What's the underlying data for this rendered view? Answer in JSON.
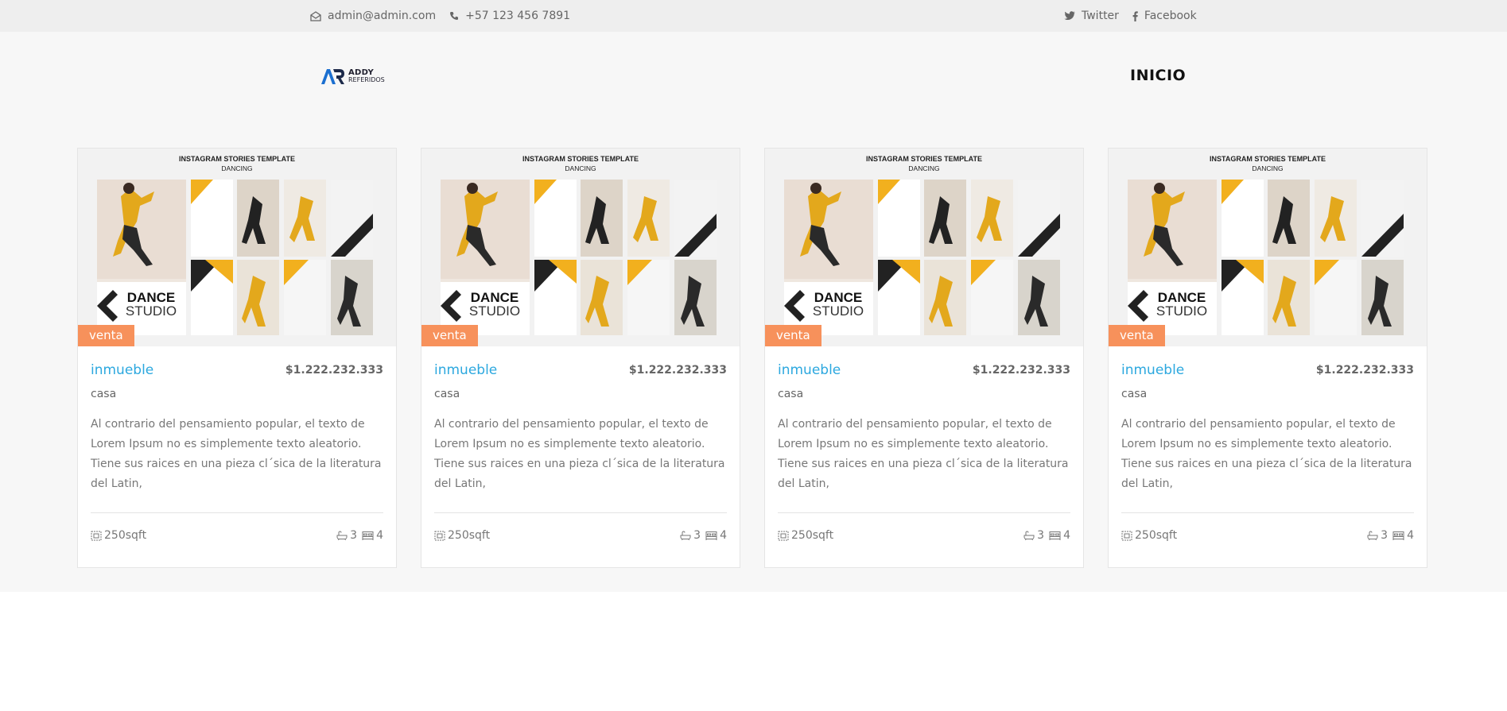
{
  "topbar": {
    "email": "admin@admin.com",
    "phone": "+57 123 456 7891",
    "twitter": "Twitter",
    "facebook": "Facebook"
  },
  "header": {
    "logo_line1": "ADDY",
    "logo_line2": "REFERIDOS",
    "nav_item": "INICIO"
  },
  "listings": [
    {
      "poster_title": "INSTAGRAM STORIES TEMPLATE",
      "poster_subtitle": "DANCING",
      "poster_brand": "DANCE",
      "poster_brand2": "STUDIO",
      "badge": "venta",
      "title": "inmueble",
      "price": "$1.222.232.333",
      "type": "casa",
      "description": "Al contrario del pensamiento popular, el texto de Lorem Ipsum no es simplemente texto aleatorio. Tiene sus raices en una pieza cl´sica de la literatura del Latin,",
      "area": "250sqft",
      "baths": "3",
      "beds": "4"
    },
    {
      "poster_title": "INSTAGRAM STORIES TEMPLATE",
      "poster_subtitle": "DANCING",
      "poster_brand": "DANCE",
      "poster_brand2": "STUDIO",
      "badge": "venta",
      "title": "inmueble",
      "price": "$1.222.232.333",
      "type": "casa",
      "description": "Al contrario del pensamiento popular, el texto de Lorem Ipsum no es simplemente texto aleatorio. Tiene sus raices en una pieza cl´sica de la literatura del Latin,",
      "area": "250sqft",
      "baths": "3",
      "beds": "4"
    },
    {
      "poster_title": "INSTAGRAM STORIES TEMPLATE",
      "poster_subtitle": "DANCING",
      "poster_brand": "DANCE",
      "poster_brand2": "STUDIO",
      "badge": "venta",
      "title": "inmueble",
      "price": "$1.222.232.333",
      "type": "casa",
      "description": "Al contrario del pensamiento popular, el texto de Lorem Ipsum no es simplemente texto aleatorio. Tiene sus raices en una pieza cl´sica de la literatura del Latin,",
      "area": "250sqft",
      "baths": "3",
      "beds": "4"
    },
    {
      "poster_title": "INSTAGRAM STORIES TEMPLATE",
      "poster_subtitle": "DANCING",
      "poster_brand": "DANCE",
      "poster_brand2": "STUDIO",
      "badge": "venta",
      "title": "inmueble",
      "price": "$1.222.232.333",
      "type": "casa",
      "description": "Al contrario del pensamiento popular, el texto de Lorem Ipsum no es simplemente texto aleatorio. Tiene sus raices en una pieza cl´sica de la literatura del Latin,",
      "area": "250sqft",
      "baths": "3",
      "beds": "4"
    }
  ],
  "colors": {
    "accent": "#2ca8df",
    "badge": "#f7915b",
    "topbar_bg": "#eeeeee",
    "section_bg": "#f7f7f7",
    "poster_yellow": "#f2b01e"
  },
  "icons": {
    "email": "envelope-icon",
    "phone": "phone-icon",
    "twitter": "twitter-icon",
    "facebook": "facebook-icon",
    "area": "area-icon",
    "baths": "bathtub-icon",
    "beds": "bed-icon"
  }
}
